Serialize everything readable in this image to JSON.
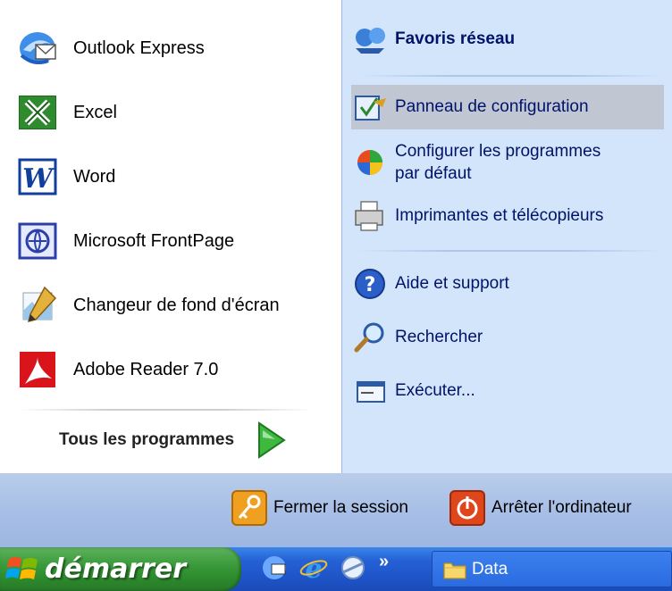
{
  "left_items": [
    {
      "label": "Outlook Express",
      "icon": "outlook-express-icon"
    },
    {
      "label": "Excel",
      "icon": "excel-icon"
    },
    {
      "label": "Word",
      "icon": "word-icon"
    },
    {
      "label": "Microsoft FrontPage",
      "icon": "frontpage-icon"
    },
    {
      "label": "Changeur de fond d'écran",
      "icon": "wallpaper-changer-icon"
    },
    {
      "label": "Adobe Reader 7.0",
      "icon": "adobe-reader-icon"
    }
  ],
  "all_programs_label": "Tous les programmes",
  "right_items": [
    {
      "label": "Favoris réseau",
      "icon": "network-places-icon",
      "bold": true
    },
    {
      "label": "Panneau de configuration",
      "icon": "control-panel-icon",
      "highlighted": true
    },
    {
      "label": "Configurer les programmes",
      "label2": "par défaut",
      "icon": "default-programs-icon"
    },
    {
      "label": "Imprimantes et télécopieurs",
      "icon": "printers-icon"
    },
    {
      "label": "Aide et support",
      "icon": "help-icon"
    },
    {
      "label": "Rechercher",
      "icon": "search-icon"
    },
    {
      "label": "Exécuter...",
      "icon": "run-icon"
    }
  ],
  "bottom": {
    "logoff_label": "Fermer la session",
    "shutdown_label": "Arrêter l'ordinateur"
  },
  "taskbar": {
    "start_label": "démarrer",
    "quick_launch_overflow": "»",
    "window_label": "Data"
  },
  "colors": {
    "start_green": "#3b9b3b",
    "taskbar_blue": "#2561d6",
    "right_panel": "#d3e5fa",
    "highlight": "#c1c6d3"
  }
}
